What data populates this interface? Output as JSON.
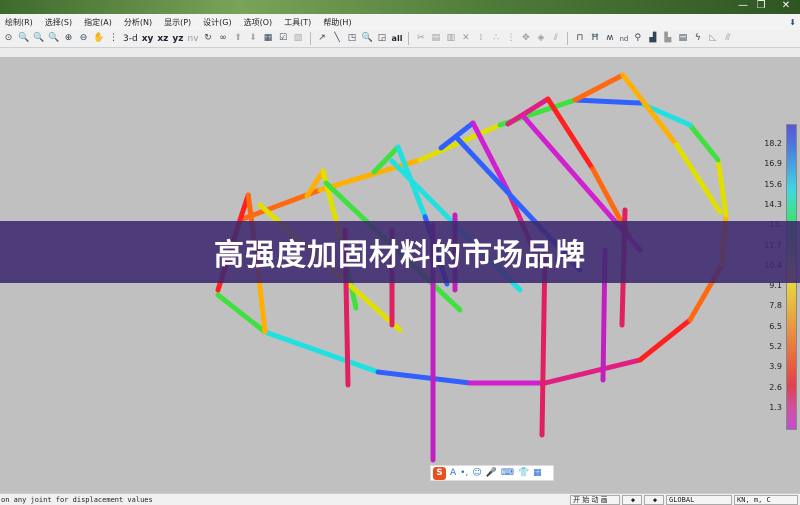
{
  "window": {
    "minimize": "—",
    "restore": "❐",
    "close": "✕"
  },
  "menu": [
    "绘制(R)",
    "选择(S)",
    "指定(A)",
    "分析(N)",
    "显示(P)",
    "设计(G)",
    "选项(O)",
    "工具(T)",
    "帮助(H)"
  ],
  "toolbar": {
    "view_3d": "3-d",
    "view_xy": "xy",
    "view_xz": "xz",
    "view_yz": "yz",
    "view_nv": "nv",
    "nd": "nd",
    "all": "all"
  },
  "banner": {
    "text": "高强度加固材料的市场品牌"
  },
  "legend": {
    "values": [
      "18.2",
      "16.9",
      "15.6",
      "14.3",
      "13.",
      "11.7",
      "10.4",
      "9.1",
      "7.8",
      "6.5",
      "5.2",
      "3.9",
      "2.6",
      "1.3"
    ],
    "colors": [
      "#5a55d8",
      "#4a7be0",
      "#4aa8e0",
      "#3fd8e0",
      "#3fe090",
      "#3fe050",
      "#8ce040",
      "#e6e040",
      "#e8c040",
      "#e8a040",
      "#e88040",
      "#e86040",
      "#e04050",
      "#d050a0",
      "#c050d0"
    ]
  },
  "ime": {
    "logo": "S",
    "items": [
      "A",
      "•,",
      "☺",
      "🎤",
      "⌨",
      "👕",
      "▦"
    ]
  },
  "statusbar": {
    "hint": "on any joint for displacement values",
    "animate": "开 始 动 画",
    "prev": "◆",
    "next": "◆",
    "coord": "GLOBAL",
    "units": "KN, m, C"
  }
}
